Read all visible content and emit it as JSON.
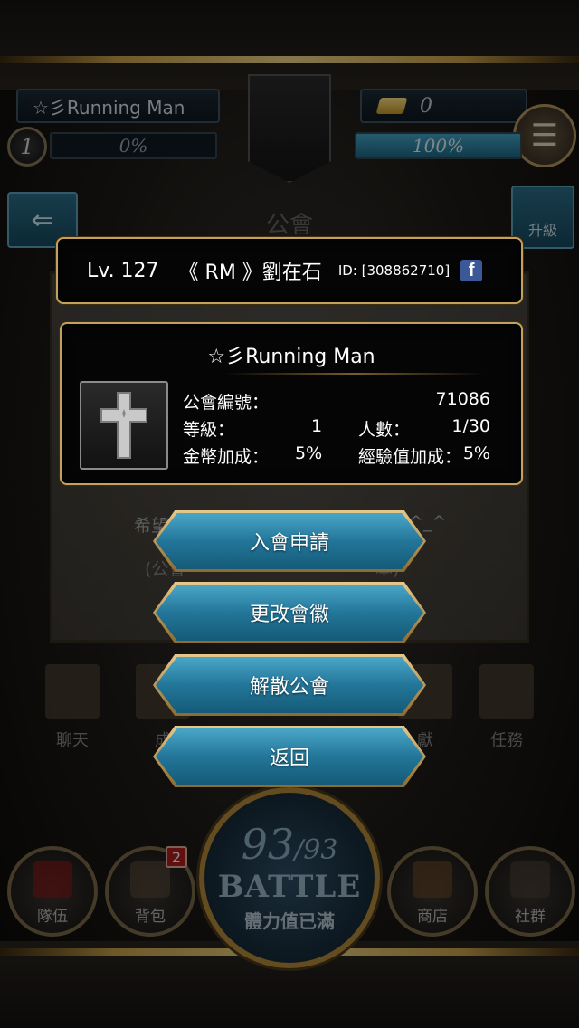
{
  "header": {
    "guild_name": "☆彡Running Man",
    "gold": "0",
    "player_level": "1",
    "xp_percent": "0%",
    "stamina_percent": "100%",
    "stamina_fill": 1.0,
    "back_glyph": "⇐",
    "menu_glyph": "☰"
  },
  "background_panel": {
    "title": "公會",
    "upgrade_label": "升級",
    "line1_left": "希望",
    "line1_right": "^_^",
    "line2_left": "(公會",
    "line2_right": "本)",
    "tabs": [
      "聊天",
      "成",
      "獻",
      "任務"
    ]
  },
  "player_card": {
    "level": "Lv. 127",
    "name": "《 RM 》劉在石",
    "id": "ID: [308862710]",
    "social_icon": "facebook-icon"
  },
  "guild_card": {
    "title": "☆彡Running Man",
    "number_label": "公會編號：",
    "number_value": "71086",
    "level_label": "等級：",
    "level_value": "1",
    "members_label": "人數：",
    "members_value": "1/30",
    "gold_bonus_label": "金幣加成：",
    "gold_bonus_value": "5%",
    "exp_bonus_label": "經驗值加成：",
    "exp_bonus_value": "5%"
  },
  "menu": {
    "apply": "入會申請",
    "change_emblem": "更改會徽",
    "disband": "解散公會",
    "back": "返回"
  },
  "bottom_nav": {
    "team": "隊伍",
    "bag": "背包",
    "bag_badge": "2",
    "shop": "商店",
    "social": "社群",
    "battle_current": "93",
    "battle_max": "/93",
    "battle_word": "BATTLE",
    "battle_status": "體力值已滿"
  }
}
